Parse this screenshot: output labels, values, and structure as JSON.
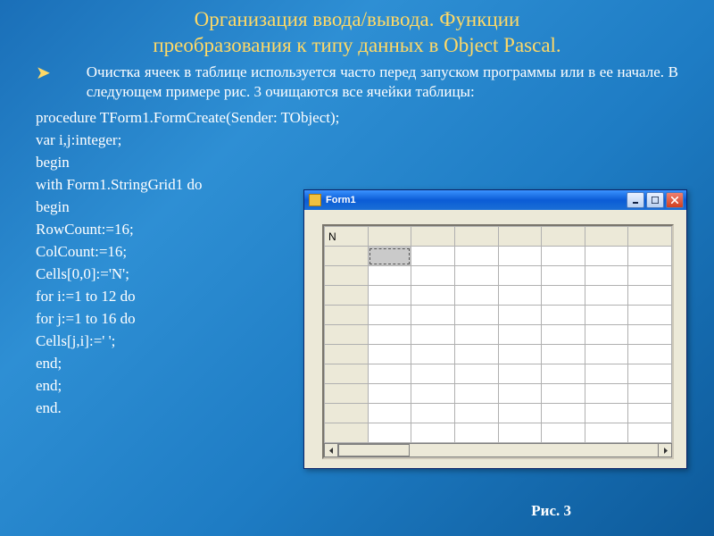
{
  "title_line1": "Организация ввода/вывода.  Функции",
  "title_line2": "преобразования к типу данных в Object Pascal.",
  "intro": "Очистка ячеек в таблице используется часто перед запуском программы или в ее начале. В следующем примере рис. 3 очищаются все ячейки таблицы:",
  "code": [
    "procedure TForm1.FormCreate(Sender: TObject);",
    "var i,j:integer;",
    "begin",
    " with Form1.StringGrid1 do",
    "begin",
    "RowCount:=16;",
    "ColCount:=16;",
    "Cells[0,0]:='N';",
    "for i:=1 to 12 do",
    "for j:=1 to 16 do",
    "Cells[j,i]:=' ';",
    "end;",
    "end;",
    "end."
  ],
  "window": {
    "title": "Form1",
    "corner_cell": "N"
  },
  "caption": "Рис. 3"
}
